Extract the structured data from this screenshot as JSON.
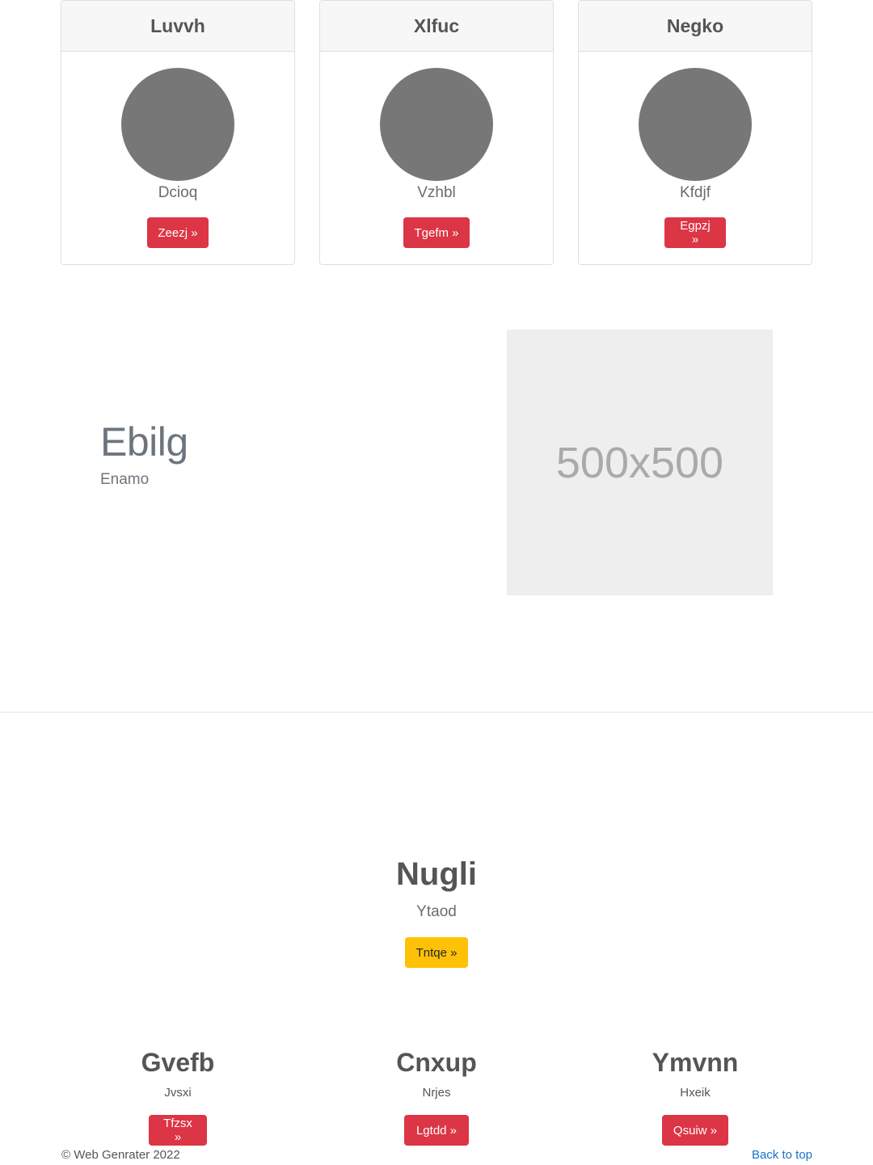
{
  "cards": [
    {
      "title": "Luvvh",
      "subtitle": "Dcioq",
      "button": "Zeezj »"
    },
    {
      "title": "Xlfuc",
      "subtitle": "Vzhbl",
      "button": "Tgefm »"
    },
    {
      "title": "Negko",
      "subtitle": "Kfdjf",
      "button": "Egpzj »"
    }
  ],
  "feature": {
    "title": "Ebilg",
    "subtitle": "Enamo",
    "placeholder_text": "500x500"
  },
  "hero": {
    "title": "Nugli",
    "subtitle": "Ytaod",
    "button": "Tntqe »"
  },
  "columns": [
    {
      "title": "Gvefb",
      "subtitle": "Jvsxi",
      "button": "Tfzsx »"
    },
    {
      "title": "Cnxup",
      "subtitle": "Nrjes",
      "button": "Lgtdd »"
    },
    {
      "title": "Ymvnn",
      "subtitle": "Hxeik",
      "button": "Qsuiw »"
    }
  ],
  "footer": {
    "copyright": "© Web Genrater 2022",
    "back_to_top": "Back to top"
  },
  "colors": {
    "primary_button": "#dc3545",
    "warning_button": "#ffc107",
    "link": "#1a73c8",
    "avatar": "#777777",
    "placeholder_bg": "#eeeeee"
  }
}
